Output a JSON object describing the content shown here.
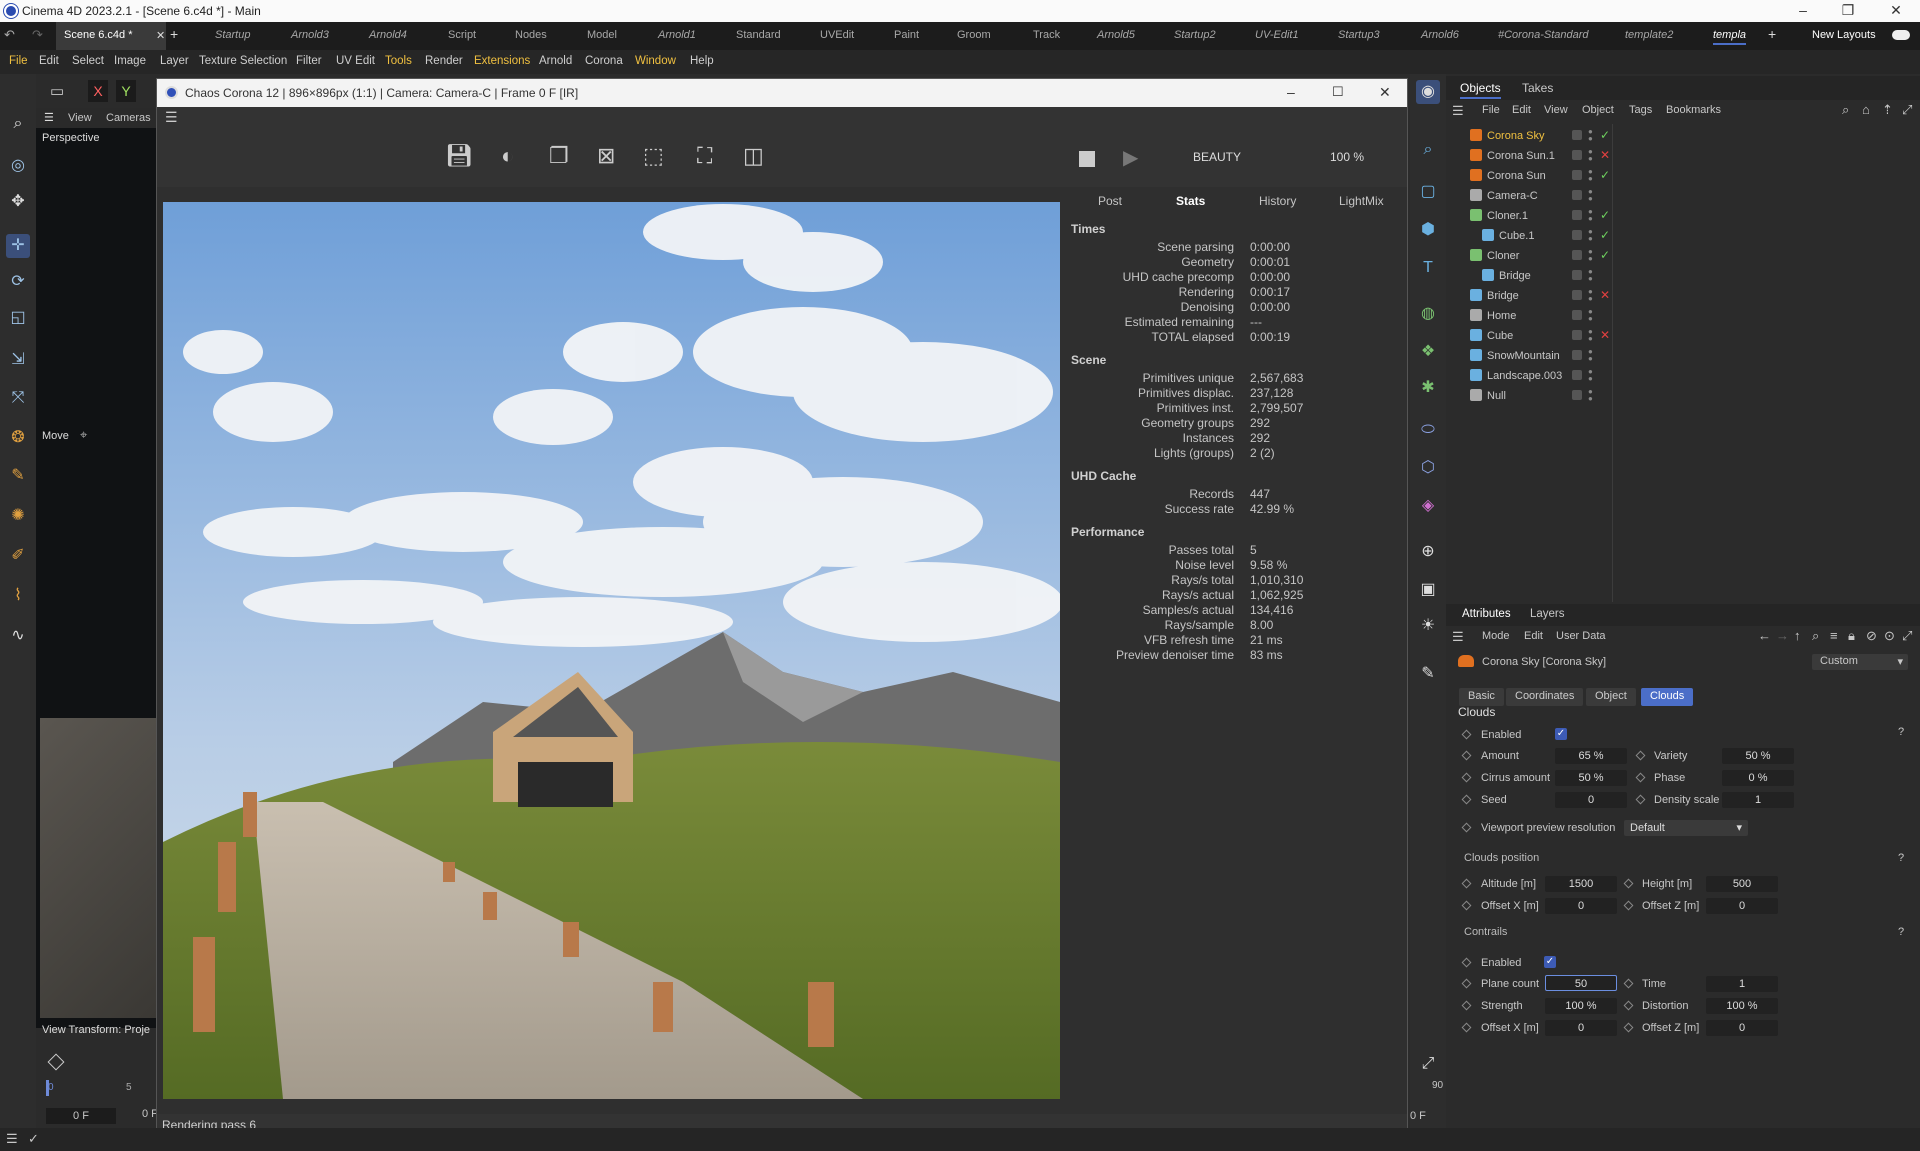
{
  "app": {
    "window_title": "Cinema 4D 2023.2.1 - [Scene 6.c4d *] - Main"
  },
  "tabs": [
    "Scene 6.c4d *",
    "Startup",
    "Arnold3",
    "Arnold4",
    "Script",
    "Nodes",
    "Model",
    "Arnold1",
    "Standard",
    "UVEdit",
    "Paint",
    "Groom",
    "Track",
    "Arnold5",
    "Startup2",
    "UV-Edit1",
    "Startup3",
    "Arnold6",
    "#Corona-Standard",
    "template2",
    "templa",
    "New Layouts"
  ],
  "menu": [
    "File",
    "Edit",
    "Select",
    "Image",
    "Layer",
    "Texture Selection",
    "Filter",
    "UV Edit",
    "Tools",
    "Render",
    "Extensions",
    "Arnold",
    "Corona",
    "Window",
    "Help"
  ],
  "viewport": {
    "view": "View",
    "cameras": "Cameras",
    "name": "Perspective",
    "move": "Move",
    "transform": "View Transform: Proje",
    "frame": "0 F",
    "frame2": "0 F",
    "tick0": "0",
    "tick5": "5",
    "tick90": "90",
    "frame_right": "0 F"
  },
  "render_window": {
    "title": "Chaos Corona 12 | 896×896px (1:1) | Camera: Camera-C | Frame 0 F [IR]",
    "pass": "BEAUTY",
    "zoom": "100 %",
    "stat_tabs": [
      "Post",
      "Stats",
      "History",
      "LightMix"
    ],
    "status": "Rendering pass 6",
    "sections": [
      {
        "name": "Times",
        "rows": [
          [
            "Scene parsing",
            "0:00:00"
          ],
          [
            "Geometry",
            "0:00:01"
          ],
          [
            "UHD cache precomp",
            "0:00:00"
          ],
          [
            "Rendering",
            "0:00:17"
          ],
          [
            "Denoising",
            "0:00:00"
          ],
          [
            "Estimated remaining",
            "---"
          ],
          [
            "TOTAL elapsed",
            "0:00:19"
          ]
        ]
      },
      {
        "name": "Scene",
        "rows": [
          [
            "Primitives unique",
            "2,567,683"
          ],
          [
            "Primitives displac.",
            "237,128"
          ],
          [
            "Primitives inst.",
            "2,799,507"
          ],
          [
            "Geometry groups",
            "292"
          ],
          [
            "Instances",
            "292"
          ],
          [
            "Lights (groups)",
            "2 (2)"
          ]
        ]
      },
      {
        "name": "UHD Cache",
        "rows": [
          [
            "Records",
            "447"
          ],
          [
            "Success rate",
            "42.99 %"
          ]
        ]
      },
      {
        "name": "Performance",
        "rows": [
          [
            "Passes total",
            "5"
          ],
          [
            "Noise level",
            "9.58 %"
          ],
          [
            "Rays/s total",
            "1,010,310"
          ],
          [
            "Rays/s actual",
            "1,062,925"
          ],
          [
            "Samples/s actual",
            "134,416"
          ],
          [
            "Rays/sample",
            "8.00"
          ],
          [
            "VFB refresh time",
            "21 ms"
          ],
          [
            "Preview denoiser time",
            "83 ms"
          ]
        ]
      }
    ]
  },
  "objects": {
    "tabs": [
      "Objects",
      "Takes"
    ],
    "menu": [
      "File",
      "Edit",
      "View",
      "Object",
      "Tags",
      "Bookmarks"
    ],
    "items": [
      {
        "name": "Corona Sky",
        "color": "#e07020",
        "indent": 0,
        "hl": true
      },
      {
        "name": "Corona Sun.1",
        "color": "#e07020",
        "indent": 0
      },
      {
        "name": "Corona Sun",
        "color": "#e07020",
        "indent": 0
      },
      {
        "name": "Camera-C",
        "color": "#aaaaaa",
        "indent": 0
      },
      {
        "name": "Cloner.1",
        "color": "#7ac070",
        "indent": 0
      },
      {
        "name": "Cube.1",
        "color": "#6ab0e0",
        "indent": 1
      },
      {
        "name": "Cloner",
        "color": "#7ac070",
        "indent": 0
      },
      {
        "name": "Bridge",
        "color": "#6ab0e0",
        "indent": 1
      },
      {
        "name": "Bridge",
        "color": "#6ab0e0",
        "indent": 0
      },
      {
        "name": "Home",
        "color": "#aaaaaa",
        "indent": 0
      },
      {
        "name": "Cube",
        "color": "#6ab0e0",
        "indent": 0
      },
      {
        "name": "SnowMountain",
        "color": "#6ab0e0",
        "indent": 0
      },
      {
        "name": "Landscape.003",
        "color": "#6ab0e0",
        "indent": 0
      },
      {
        "name": "Null",
        "color": "#aaaaaa",
        "indent": 0
      }
    ]
  },
  "attributes": {
    "tabs": [
      "Attributes",
      "Layers"
    ],
    "menu": [
      "Mode",
      "Edit",
      "User Data"
    ],
    "object": "Corona Sky [Corona Sky]",
    "preset": "Custom",
    "subtabs": [
      "Basic",
      "Coordinates",
      "Object",
      "Clouds"
    ],
    "section": "Clouds",
    "enabled": "Enabled",
    "amount": "Amount",
    "amount_v": "65 %",
    "variety": "Variety",
    "variety_v": "50 %",
    "cirrus": "Cirrus amount",
    "cirrus_v": "50 %",
    "phase": "Phase",
    "phase_v": "0 %",
    "seed": "Seed",
    "seed_v": "0",
    "density": "Density scale",
    "density_v": "1",
    "vpr": "Viewport preview resolution",
    "vpr_v": "Default",
    "pos": "Clouds position",
    "alt": "Altitude [m]",
    "alt_v": "1500",
    "height": "Height [m]",
    "height_v": "500",
    "offx": "Offset X [m]",
    "offx_v": "0",
    "offz": "Offset Z [m]",
    "offz_v": "0",
    "contrails": "Contrails",
    "c_enabled": "Enabled",
    "plane": "Plane count",
    "plane_v": "50",
    "time": "Time",
    "time_v": "1",
    "strength": "Strength",
    "strength_v": "100 %",
    "distortion": "Distortion",
    "distortion_v": "100 %",
    "c_offx": "Offset X [m]",
    "c_offx_v": "0",
    "c_offz": "Offset Z [m]",
    "c_offz_v": "0",
    "q": "?"
  }
}
